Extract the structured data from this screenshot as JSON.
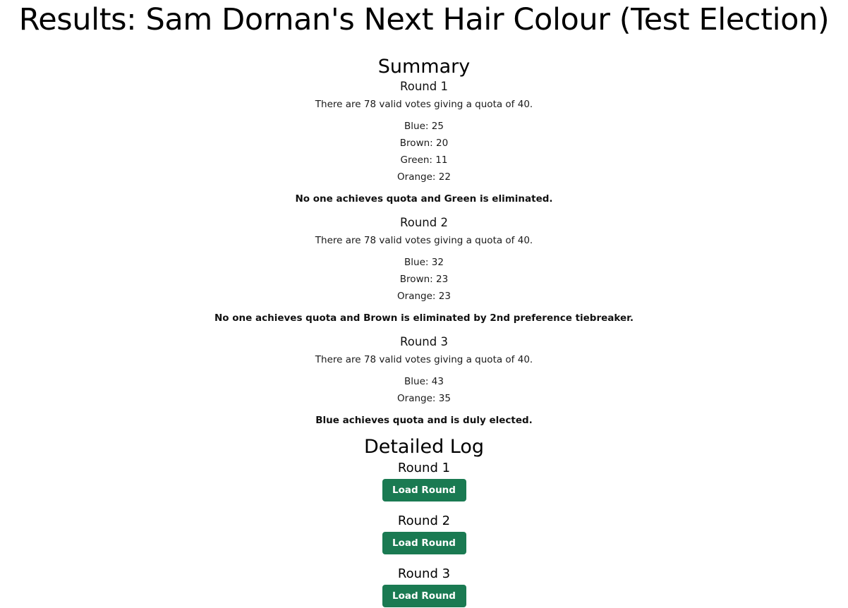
{
  "page": {
    "title": "Results: Sam Dornan's Next Hair Colour (Test Election)"
  },
  "summary": {
    "heading": "Summary",
    "rounds": [
      {
        "label": "Round 1",
        "quota_text": "There are 78 valid votes giving a quota of 40.",
        "tallies": [
          "Blue: 25",
          "Brown: 20",
          "Green: 11",
          "Orange: 22"
        ],
        "outcome": "No one achieves quota and Green is eliminated."
      },
      {
        "label": "Round 2",
        "quota_text": "There are 78 valid votes giving a quota of 40.",
        "tallies": [
          "Blue: 32",
          "Brown: 23",
          "Orange: 23"
        ],
        "outcome": "No one achieves quota and Brown is eliminated by 2nd preference tiebreaker."
      },
      {
        "label": "Round 3",
        "quota_text": "There are 78 valid votes giving a quota of 40.",
        "tallies": [
          "Blue: 43",
          "Orange: 35"
        ],
        "outcome": "Blue achieves quota and is duly elected."
      }
    ]
  },
  "detailed_log": {
    "heading": "Detailed Log",
    "rounds": [
      {
        "label": "Round 1",
        "button_label": "Load Round"
      },
      {
        "label": "Round 2",
        "button_label": "Load Round"
      },
      {
        "label": "Round 3",
        "button_label": "Load Round"
      }
    ]
  },
  "colors": {
    "button_bg": "#1a7a52",
    "button_text": "#ffffff"
  }
}
